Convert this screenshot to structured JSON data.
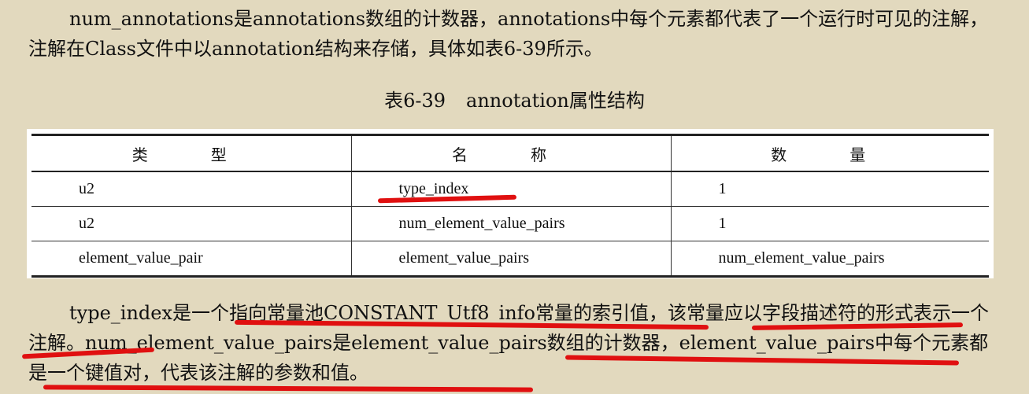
{
  "intro_paragraph": "num_annotations是annotations数组的计数器，annotations中每个元素都代表了一个运行时可见的注解，注解在Class文件中以annotation结构来存储，具体如表6-39所示。",
  "table_caption": {
    "number": "表6-39",
    "title": "annotation属性结构"
  },
  "table": {
    "headers": [
      "类　型",
      "名　称",
      "数　量"
    ],
    "rows": [
      [
        "u2",
        "type_index",
        "1"
      ],
      [
        "u2",
        "num_element_value_pairs",
        "1"
      ],
      [
        "element_value_pair",
        "element_value_pairs",
        "num_element_value_pairs"
      ]
    ]
  },
  "body_paragraph": "type_index是一个指向常量池CONSTANT_Utf8_info常量的索引值，该常量应以字段描述符的形式表示一个注解。num_element_value_pairs是element_value_pairs数组的计数器，element_value_pairs中每个元素都是一个键值对，代表该注解的参数和值。",
  "annotation_color": "#e01010"
}
